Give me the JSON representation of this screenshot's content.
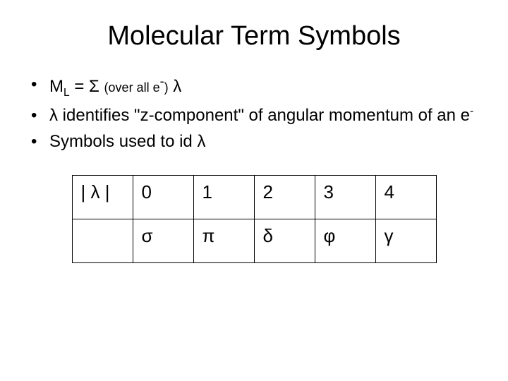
{
  "title": "Molecular Term Symbols",
  "bullets": {
    "b1_text": "M",
    "b1_sub": "L",
    "b1_eq": " = Σ ",
    "b1_paren": "(over all e",
    "b1_paren_sup": "-",
    "b1_paren_close": ")",
    "b1_lambda": " λ",
    "b2_lambda": " λ",
    "b2_text": " identifies \"z-component\" of angular momentum of an e",
    "b2_sup": "-",
    "b3_text": "Symbols used to id ",
    "b3_lambda": "λ"
  },
  "table": {
    "r1c1": "| λ |",
    "r1c2": "0",
    "r1c3": "1",
    "r1c4": "2",
    "r1c5": "3",
    "r1c6": "4",
    "r2c1": "",
    "r2c2": "σ",
    "r2c3": "π",
    "r2c4": "δ",
    "r2c5": "φ",
    "r2c6": "γ"
  }
}
